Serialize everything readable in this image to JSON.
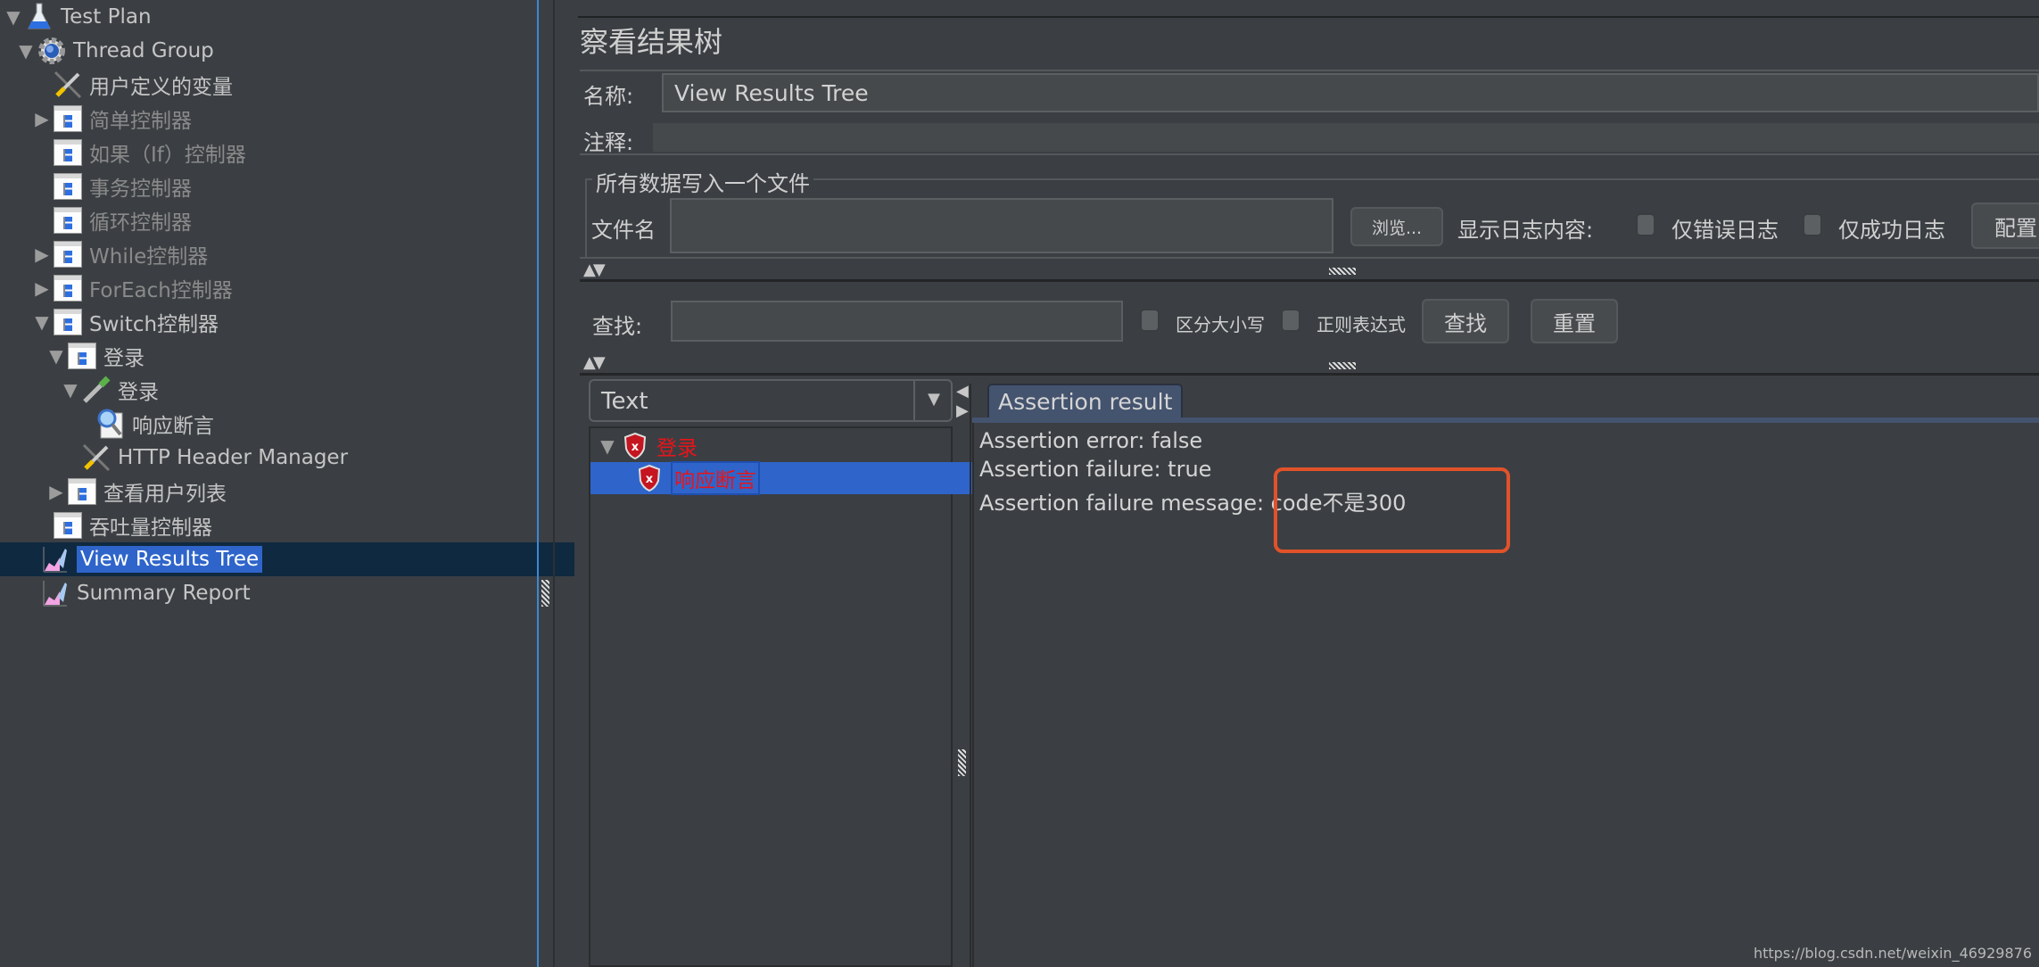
{
  "tree": {
    "items": [
      {
        "label": "Test Plan",
        "icon": "test-plan-flask-icon",
        "expanded": true,
        "enabled": true
      },
      {
        "label": "Thread Group",
        "icon": "thread-group-gear-icon",
        "expanded": true,
        "enabled": true
      },
      {
        "label": "用户定义的变量",
        "icon": "config-wrench-icon",
        "enabled": true
      },
      {
        "label": "简单控制器",
        "icon": "controller-icon",
        "collapsed": true,
        "enabled": false
      },
      {
        "label": "如果（If）控制器",
        "icon": "controller-icon",
        "enabled": false
      },
      {
        "label": "事务控制器",
        "icon": "controller-icon",
        "enabled": false
      },
      {
        "label": "循环控制器",
        "icon": "controller-icon",
        "enabled": false
      },
      {
        "label": "While控制器",
        "icon": "controller-icon",
        "collapsed": true,
        "enabled": false
      },
      {
        "label": "ForEach控制器",
        "icon": "controller-icon",
        "collapsed": true,
        "enabled": false
      },
      {
        "label": "Switch控制器",
        "icon": "controller-icon",
        "expanded": true,
        "enabled": true
      },
      {
        "label": "登录",
        "icon": "controller-icon",
        "expanded": true,
        "enabled": true
      },
      {
        "label": "登录",
        "icon": "sampler-pipette-icon",
        "expanded": true,
        "enabled": true
      },
      {
        "label": "响应断言",
        "icon": "assertion-magnifier-icon",
        "enabled": true
      },
      {
        "label": "HTTP Header Manager",
        "icon": "config-wrench-icon",
        "enabled": true
      },
      {
        "label": "查看用户列表",
        "icon": "controller-icon",
        "collapsed": true,
        "enabled": true
      },
      {
        "label": "吞吐量控制器",
        "icon": "controller-icon",
        "enabled": true
      },
      {
        "label": "View Results Tree",
        "icon": "listener-graph-icon",
        "selected": true,
        "enabled": true
      },
      {
        "label": "Summary Report",
        "icon": "listener-graph-icon",
        "enabled": true
      }
    ]
  },
  "panel": {
    "title": "察看结果树",
    "name_label": "名称:",
    "name_value": "View Results Tree",
    "comment_label": "注释:",
    "comment_value": "",
    "file_group_label": "所有数据写入一个文件",
    "filename_label": "文件名",
    "filename_value": "",
    "browse_label": "浏览...",
    "log_content_label": "显示日志内容:",
    "errors_only_label": "仅错误日志",
    "success_only_label": "仅成功日志",
    "configure_label": "配置",
    "search_label": "查找:",
    "search_value": "",
    "case_sensitive_label": "区分大小写",
    "regex_label": "正则表达式",
    "find_button": "查找",
    "reset_button": "重置"
  },
  "results": {
    "renderer": "Text",
    "tree": [
      {
        "label": "登录",
        "status": "failed",
        "expanded": true
      },
      {
        "label": "响应断言",
        "status": "failed",
        "selected": true
      }
    ],
    "tab_label": "Assertion result",
    "lines": [
      "Assertion error: false",
      "Assertion failure: true",
      "Assertion failure message: code不是300"
    ]
  },
  "colors": {
    "selection": "#2f65ca",
    "failed_text": "#e8141a",
    "highlight_box": "#e2522a"
  },
  "watermark": "https://blog.csdn.net/weixin_46929876"
}
